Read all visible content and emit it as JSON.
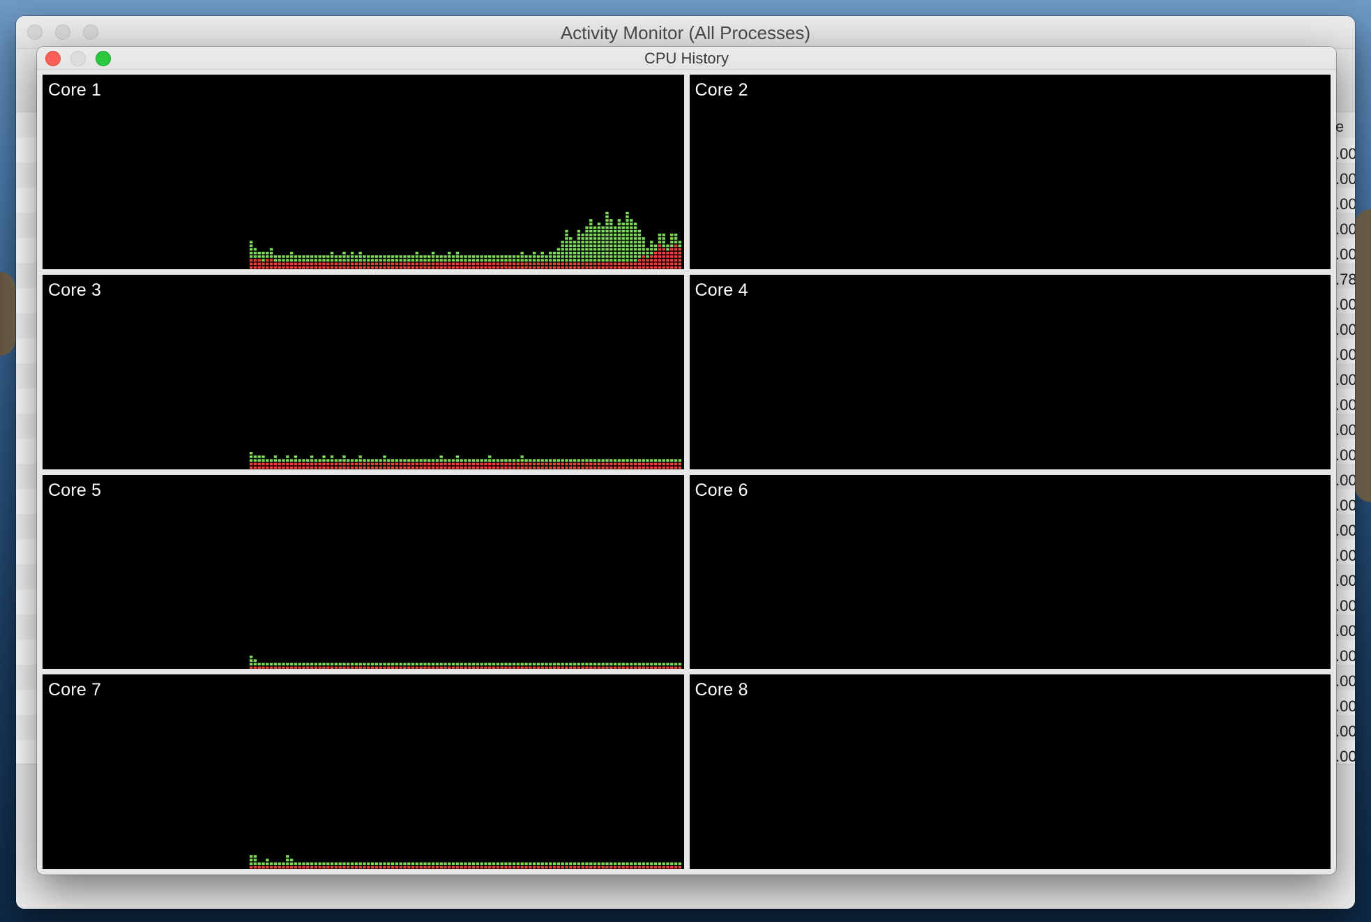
{
  "back_window": {
    "title": "Activity Monitor (All Processes)",
    "column_header_fragment": "e",
    "column_fragments": [
      ".00",
      ".00",
      ".00",
      ".00",
      ".00",
      ".78",
      ".00",
      ".00",
      ".00",
      ".00",
      ".00",
      ".00",
      ".00",
      ".00",
      ".00",
      ".00",
      ".00",
      ".00",
      ".00",
      ".00",
      ".00",
      ".00",
      ".00",
      ".00",
      ".00"
    ]
  },
  "cpu_history_window": {
    "title": "CPU History",
    "colors": {
      "user": "#7ddc5a",
      "system": "#e8443a",
      "background": "#000000"
    },
    "cores": [
      {
        "label": "Core 1",
        "user": [
          5,
          3,
          2,
          3,
          2,
          3,
          2,
          2,
          2,
          2,
          3,
          2,
          2,
          2,
          2,
          2,
          2,
          2,
          2,
          2,
          3,
          2,
          2,
          3,
          2,
          3,
          2,
          3,
          2,
          2,
          2,
          2,
          2,
          2,
          2,
          2,
          2,
          2,
          2,
          2,
          2,
          3,
          2,
          2,
          2,
          3,
          2,
          2,
          2,
          3,
          2,
          3,
          2,
          2,
          2,
          2,
          2,
          2,
          2,
          2,
          2,
          2,
          2,
          2,
          2,
          2,
          2,
          3,
          2,
          2,
          3,
          2,
          3,
          2,
          3,
          3,
          4,
          6,
          9,
          7,
          6,
          9,
          8,
          10,
          12,
          10,
          11,
          10,
          14,
          12,
          10,
          12,
          11,
          14,
          12,
          11,
          8,
          5,
          3,
          4,
          2,
          3,
          4,
          2,
          4,
          3,
          2
        ],
        "system": [
          3,
          3,
          3,
          2,
          3,
          3,
          2,
          2,
          2,
          2,
          2,
          2,
          2,
          2,
          2,
          2,
          2,
          2,
          2,
          2,
          2,
          2,
          2,
          2,
          2,
          2,
          2,
          2,
          2,
          2,
          2,
          2,
          2,
          2,
          2,
          2,
          2,
          2,
          2,
          2,
          2,
          2,
          2,
          2,
          2,
          2,
          2,
          2,
          2,
          2,
          2,
          2,
          2,
          2,
          2,
          2,
          2,
          2,
          2,
          2,
          2,
          2,
          2,
          2,
          2,
          2,
          2,
          2,
          2,
          2,
          2,
          2,
          2,
          2,
          2,
          2,
          2,
          2,
          2,
          2,
          2,
          2,
          2,
          2,
          2,
          2,
          2,
          2,
          2,
          2,
          2,
          2,
          2,
          2,
          2,
          2,
          3,
          4,
          3,
          4,
          5,
          7,
          6,
          5,
          6,
          7,
          6
        ]
      },
      {
        "label": "Core 2",
        "user": [],
        "system": []
      },
      {
        "label": "Core 3",
        "user": [
          3,
          2,
          2,
          2,
          1,
          1,
          2,
          1,
          1,
          2,
          1,
          2,
          1,
          1,
          1,
          2,
          1,
          1,
          2,
          1,
          2,
          1,
          1,
          2,
          1,
          1,
          1,
          2,
          1,
          1,
          1,
          1,
          1,
          2,
          1,
          1,
          1,
          1,
          1,
          1,
          1,
          1,
          1,
          1,
          1,
          1,
          1,
          2,
          1,
          1,
          1,
          2,
          1,
          1,
          1,
          1,
          1,
          1,
          1,
          2,
          1,
          1,
          1,
          1,
          1,
          1,
          1,
          2,
          1,
          1,
          1,
          1,
          1,
          1,
          1,
          1,
          1,
          1,
          1,
          1,
          1,
          1,
          1,
          1,
          1,
          1,
          1,
          1,
          1,
          1,
          1,
          1,
          1,
          1,
          1,
          1,
          1,
          1,
          1,
          1,
          1,
          1,
          1,
          1,
          1,
          1,
          1
        ],
        "system": [
          2,
          2,
          2,
          2,
          2,
          2,
          2,
          2,
          2,
          2,
          2,
          2,
          2,
          2,
          2,
          2,
          2,
          2,
          2,
          2,
          2,
          2,
          2,
          2,
          2,
          2,
          2,
          2,
          2,
          2,
          2,
          2,
          2,
          2,
          2,
          2,
          2,
          2,
          2,
          2,
          2,
          2,
          2,
          2,
          2,
          2,
          2,
          2,
          2,
          2,
          2,
          2,
          2,
          2,
          2,
          2,
          2,
          2,
          2,
          2,
          2,
          2,
          2,
          2,
          2,
          2,
          2,
          2,
          2,
          2,
          2,
          2,
          2,
          2,
          2,
          2,
          2,
          2,
          2,
          2,
          2,
          2,
          2,
          2,
          2,
          2,
          2,
          2,
          2,
          2,
          2,
          2,
          2,
          2,
          2,
          2,
          2,
          2,
          2,
          2,
          2,
          2,
          2,
          2,
          2,
          2,
          2
        ]
      },
      {
        "label": "Core 4",
        "user": [],
        "system": []
      },
      {
        "label": "Core 5",
        "user": [
          3,
          2,
          1,
          1,
          1,
          1,
          1,
          1,
          1,
          1,
          1,
          1,
          1,
          1,
          1,
          1,
          1,
          1,
          1,
          1,
          1,
          1,
          1,
          1,
          1,
          1,
          1,
          1,
          1,
          1,
          1,
          1,
          1,
          1,
          1,
          1,
          1,
          1,
          1,
          1,
          1,
          1,
          1,
          1,
          1,
          1,
          1,
          1,
          1,
          1,
          1,
          1,
          1,
          1,
          1,
          1,
          1,
          1,
          1,
          1,
          1,
          1,
          1,
          1,
          1,
          1,
          1,
          1,
          1,
          1,
          1,
          1,
          1,
          1,
          1,
          1,
          1,
          1,
          1,
          1,
          1,
          1,
          1,
          1,
          1,
          1,
          1,
          1,
          1,
          1,
          1,
          1,
          1,
          1,
          1,
          1,
          1,
          1,
          1,
          1,
          1,
          1,
          1,
          1,
          1,
          1,
          1
        ],
        "system": [
          1,
          1,
          1,
          1,
          1,
          1,
          1,
          1,
          1,
          1,
          1,
          1,
          1,
          1,
          1,
          1,
          1,
          1,
          1,
          1,
          1,
          1,
          1,
          1,
          1,
          1,
          1,
          1,
          1,
          1,
          1,
          1,
          1,
          1,
          1,
          1,
          1,
          1,
          1,
          1,
          1,
          1,
          1,
          1,
          1,
          1,
          1,
          1,
          1,
          1,
          1,
          1,
          1,
          1,
          1,
          1,
          1,
          1,
          1,
          1,
          1,
          1,
          1,
          1,
          1,
          1,
          1,
          1,
          1,
          1,
          1,
          1,
          1,
          1,
          1,
          1,
          1,
          1,
          1,
          1,
          1,
          1,
          1,
          1,
          1,
          1,
          1,
          1,
          1,
          1,
          1,
          1,
          1,
          1,
          1,
          1,
          1,
          1,
          1,
          1,
          1,
          1,
          1,
          1,
          1,
          1,
          1
        ]
      },
      {
        "label": "Core 6",
        "user": [],
        "system": []
      },
      {
        "label": "Core 7",
        "user": [
          3,
          3,
          1,
          1,
          2,
          1,
          1,
          1,
          1,
          3,
          2,
          1,
          1,
          1,
          1,
          1,
          1,
          1,
          1,
          1,
          1,
          1,
          1,
          1,
          1,
          1,
          1,
          1,
          1,
          1,
          1,
          1,
          1,
          1,
          1,
          1,
          1,
          1,
          1,
          1,
          1,
          1,
          1,
          1,
          1,
          1,
          1,
          1,
          1,
          1,
          1,
          1,
          1,
          1,
          1,
          1,
          1,
          1,
          1,
          1,
          1,
          1,
          1,
          1,
          1,
          1,
          1,
          1,
          1,
          1,
          1,
          1,
          1,
          1,
          1,
          1,
          1,
          1,
          1,
          1,
          1,
          1,
          1,
          1,
          1,
          1,
          1,
          1,
          1,
          1,
          1,
          1,
          1,
          1,
          1,
          1,
          1,
          1,
          1,
          1,
          1,
          1,
          1,
          1,
          1,
          1,
          1
        ],
        "system": [
          1,
          1,
          1,
          1,
          1,
          1,
          1,
          1,
          1,
          1,
          1,
          1,
          1,
          1,
          1,
          1,
          1,
          1,
          1,
          1,
          1,
          1,
          1,
          1,
          1,
          1,
          1,
          1,
          1,
          1,
          1,
          1,
          1,
          1,
          1,
          1,
          1,
          1,
          1,
          1,
          1,
          1,
          1,
          1,
          1,
          1,
          1,
          1,
          1,
          1,
          1,
          1,
          1,
          1,
          1,
          1,
          1,
          1,
          1,
          1,
          1,
          1,
          1,
          1,
          1,
          1,
          1,
          1,
          1,
          1,
          1,
          1,
          1,
          1,
          1,
          1,
          1,
          1,
          1,
          1,
          1,
          1,
          1,
          1,
          1,
          1,
          1,
          1,
          1,
          1,
          1,
          1,
          1,
          1,
          1,
          1,
          1,
          1,
          1,
          1,
          1,
          1,
          1,
          1,
          1,
          1,
          1
        ]
      },
      {
        "label": "Core 8",
        "user": [],
        "system": []
      }
    ]
  }
}
